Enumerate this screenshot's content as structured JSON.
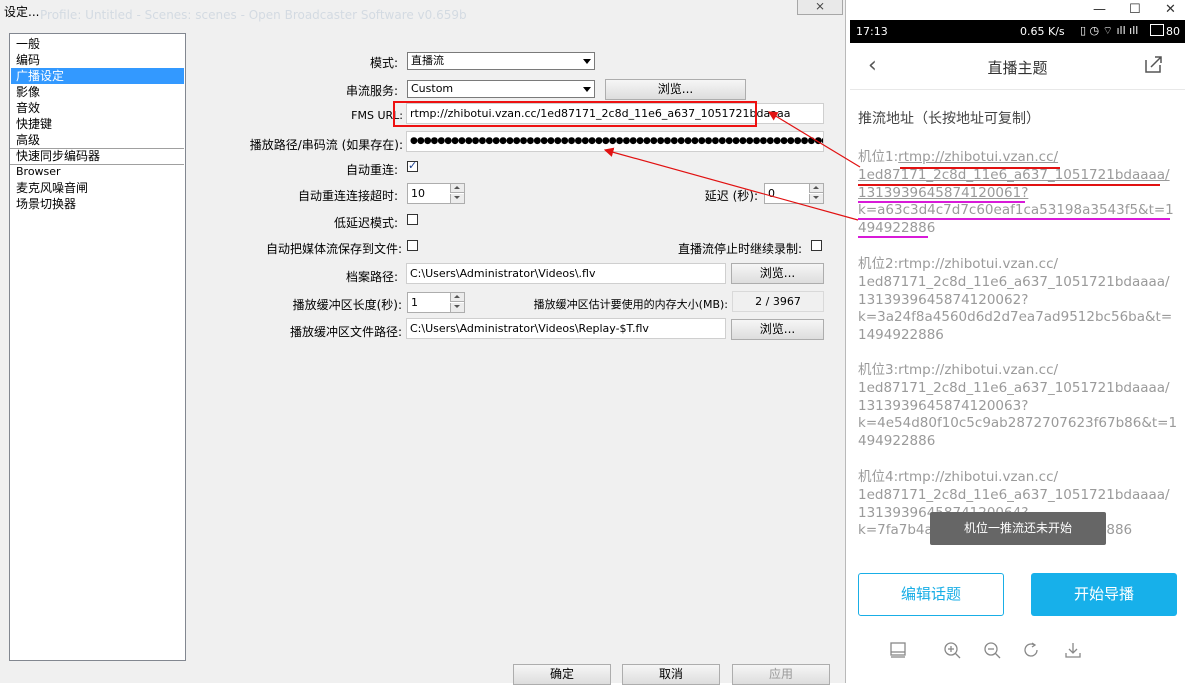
{
  "dialog": {
    "title": "设定...",
    "close_glyph": "⨯",
    "faded_title": "Profile: Untitled - Scenes: scenes - Open Broadcaster Software v0.659b",
    "categories": [
      "一般",
      "编码",
      "广播设定",
      "影像",
      "音效",
      "快捷键",
      "高级",
      "快速同步编码器",
      "Browser",
      "麦克风噪音闸",
      "场景切换器"
    ],
    "selected_category": "广播设定",
    "mode": {
      "label": "模式:",
      "value": "直播流"
    },
    "service": {
      "label": "串流服务:",
      "value": "Custom",
      "browse": "浏览..."
    },
    "fms_url": {
      "label": "FMS URL:",
      "value": "rtmp://zhibotui.vzan.cc/1ed87171_2c8d_11e6_a637_1051721bdaaaa"
    },
    "play_path": {
      "label": "播放路径/串码流 (如果存在):",
      "value": "●●●●●●●●●●●●●●●●●●●●●●●●●●●●●●●●●●●●●●●●●●●●●●●●●●●●●●●●●●●●●●●●●●●●"
    },
    "auto_reconnect": {
      "label": "自动重连:",
      "checked": true
    },
    "reconnect_timeout": {
      "label": "自动重连连接超时:",
      "value": "10"
    },
    "delay": {
      "label": "延迟 (秒):",
      "value": "0"
    },
    "low_latency": {
      "label": "低延迟模式:",
      "checked": false
    },
    "save_to_file": {
      "label": "自动把媒体流保存到文件:",
      "checked": false
    },
    "keep_recording": {
      "label": "直播流停止时继续录制:",
      "checked": false
    },
    "file_path": {
      "label": "档案路径:",
      "value": "C:\\Users\\Administrator\\Videos\\.flv",
      "browse": "浏览..."
    },
    "replay_buffer": {
      "label": "播放缓冲区长度(秒):",
      "value": "1"
    },
    "replay_memory": {
      "label": "播放缓冲区估计要使用的内存大小(MB):",
      "value": "2 / 3967"
    },
    "replay_path": {
      "label": "播放缓冲区文件路径:",
      "value": "C:\\Users\\Administrator\\Videos\\Replay-$T.flv",
      "browse": "浏览..."
    },
    "buttons": {
      "ok": "确定",
      "cancel": "取消",
      "apply": "应用"
    }
  },
  "window_controls": {
    "minimize": "—",
    "maximize": "☐",
    "close": "✕"
  },
  "phone": {
    "status": {
      "time": "17:13",
      "speed": "0.65 K/s",
      "battery": "80"
    },
    "title": "直播主题",
    "section_title": "推流地址（长按地址可复制）",
    "slots": [
      {
        "label": "机位1:",
        "line1": "rtmp://zhibotui.vzan.cc/",
        "line2": "1ed87171_2c8d_11e6_a637_1051721bdaaaa/",
        "line3": "1313939645874120061?",
        "line4": "k=a63c3d4c7d7c60eaf1ca53198a3543f5&t=1494922886"
      },
      {
        "label": "机位2:",
        "line1": "rtmp://zhibotui.vzan.cc/",
        "line2": "1ed87171_2c8d_11e6_a637_1051721bdaaaa/",
        "line3": "1313939645874120062?",
        "line4": "k=3a24f8a4560d6d2d7ea7ad9512bc56ba&t=1494922886"
      },
      {
        "label": "机位3:",
        "line1": "rtmp://zhibotui.vzan.cc/",
        "line2": "1ed87171_2c8d_11e6_a637_1051721bdaaaa/",
        "line3": "1313939645874120063?",
        "line4": "k=4e54d80f10c5c9ab2872707623f67b86&t=1494922886"
      },
      {
        "label": "机位4:",
        "line1": "rtmp://zhibotui.vzan.cc/",
        "line2": "1ed87171_2c8d_11e6_a637_1051721bdaaaa/",
        "line3": "1313939645874120064?",
        "line4": "k=7fa7b4a2fa…90956a&t=1494922886"
      }
    ],
    "toast": "机位一推流还未开始",
    "edit_button": "编辑话题",
    "start_button": "开始导播",
    "colors": {
      "accent": "#17b0ea",
      "annotation_red": "#e11111",
      "annotation_magenta": "#d81bd8"
    },
    "toolbar_icons": [
      "layout-icon",
      "zoom-in-icon",
      "zoom-out-icon",
      "rotate-icon",
      "download-icon"
    ]
  }
}
